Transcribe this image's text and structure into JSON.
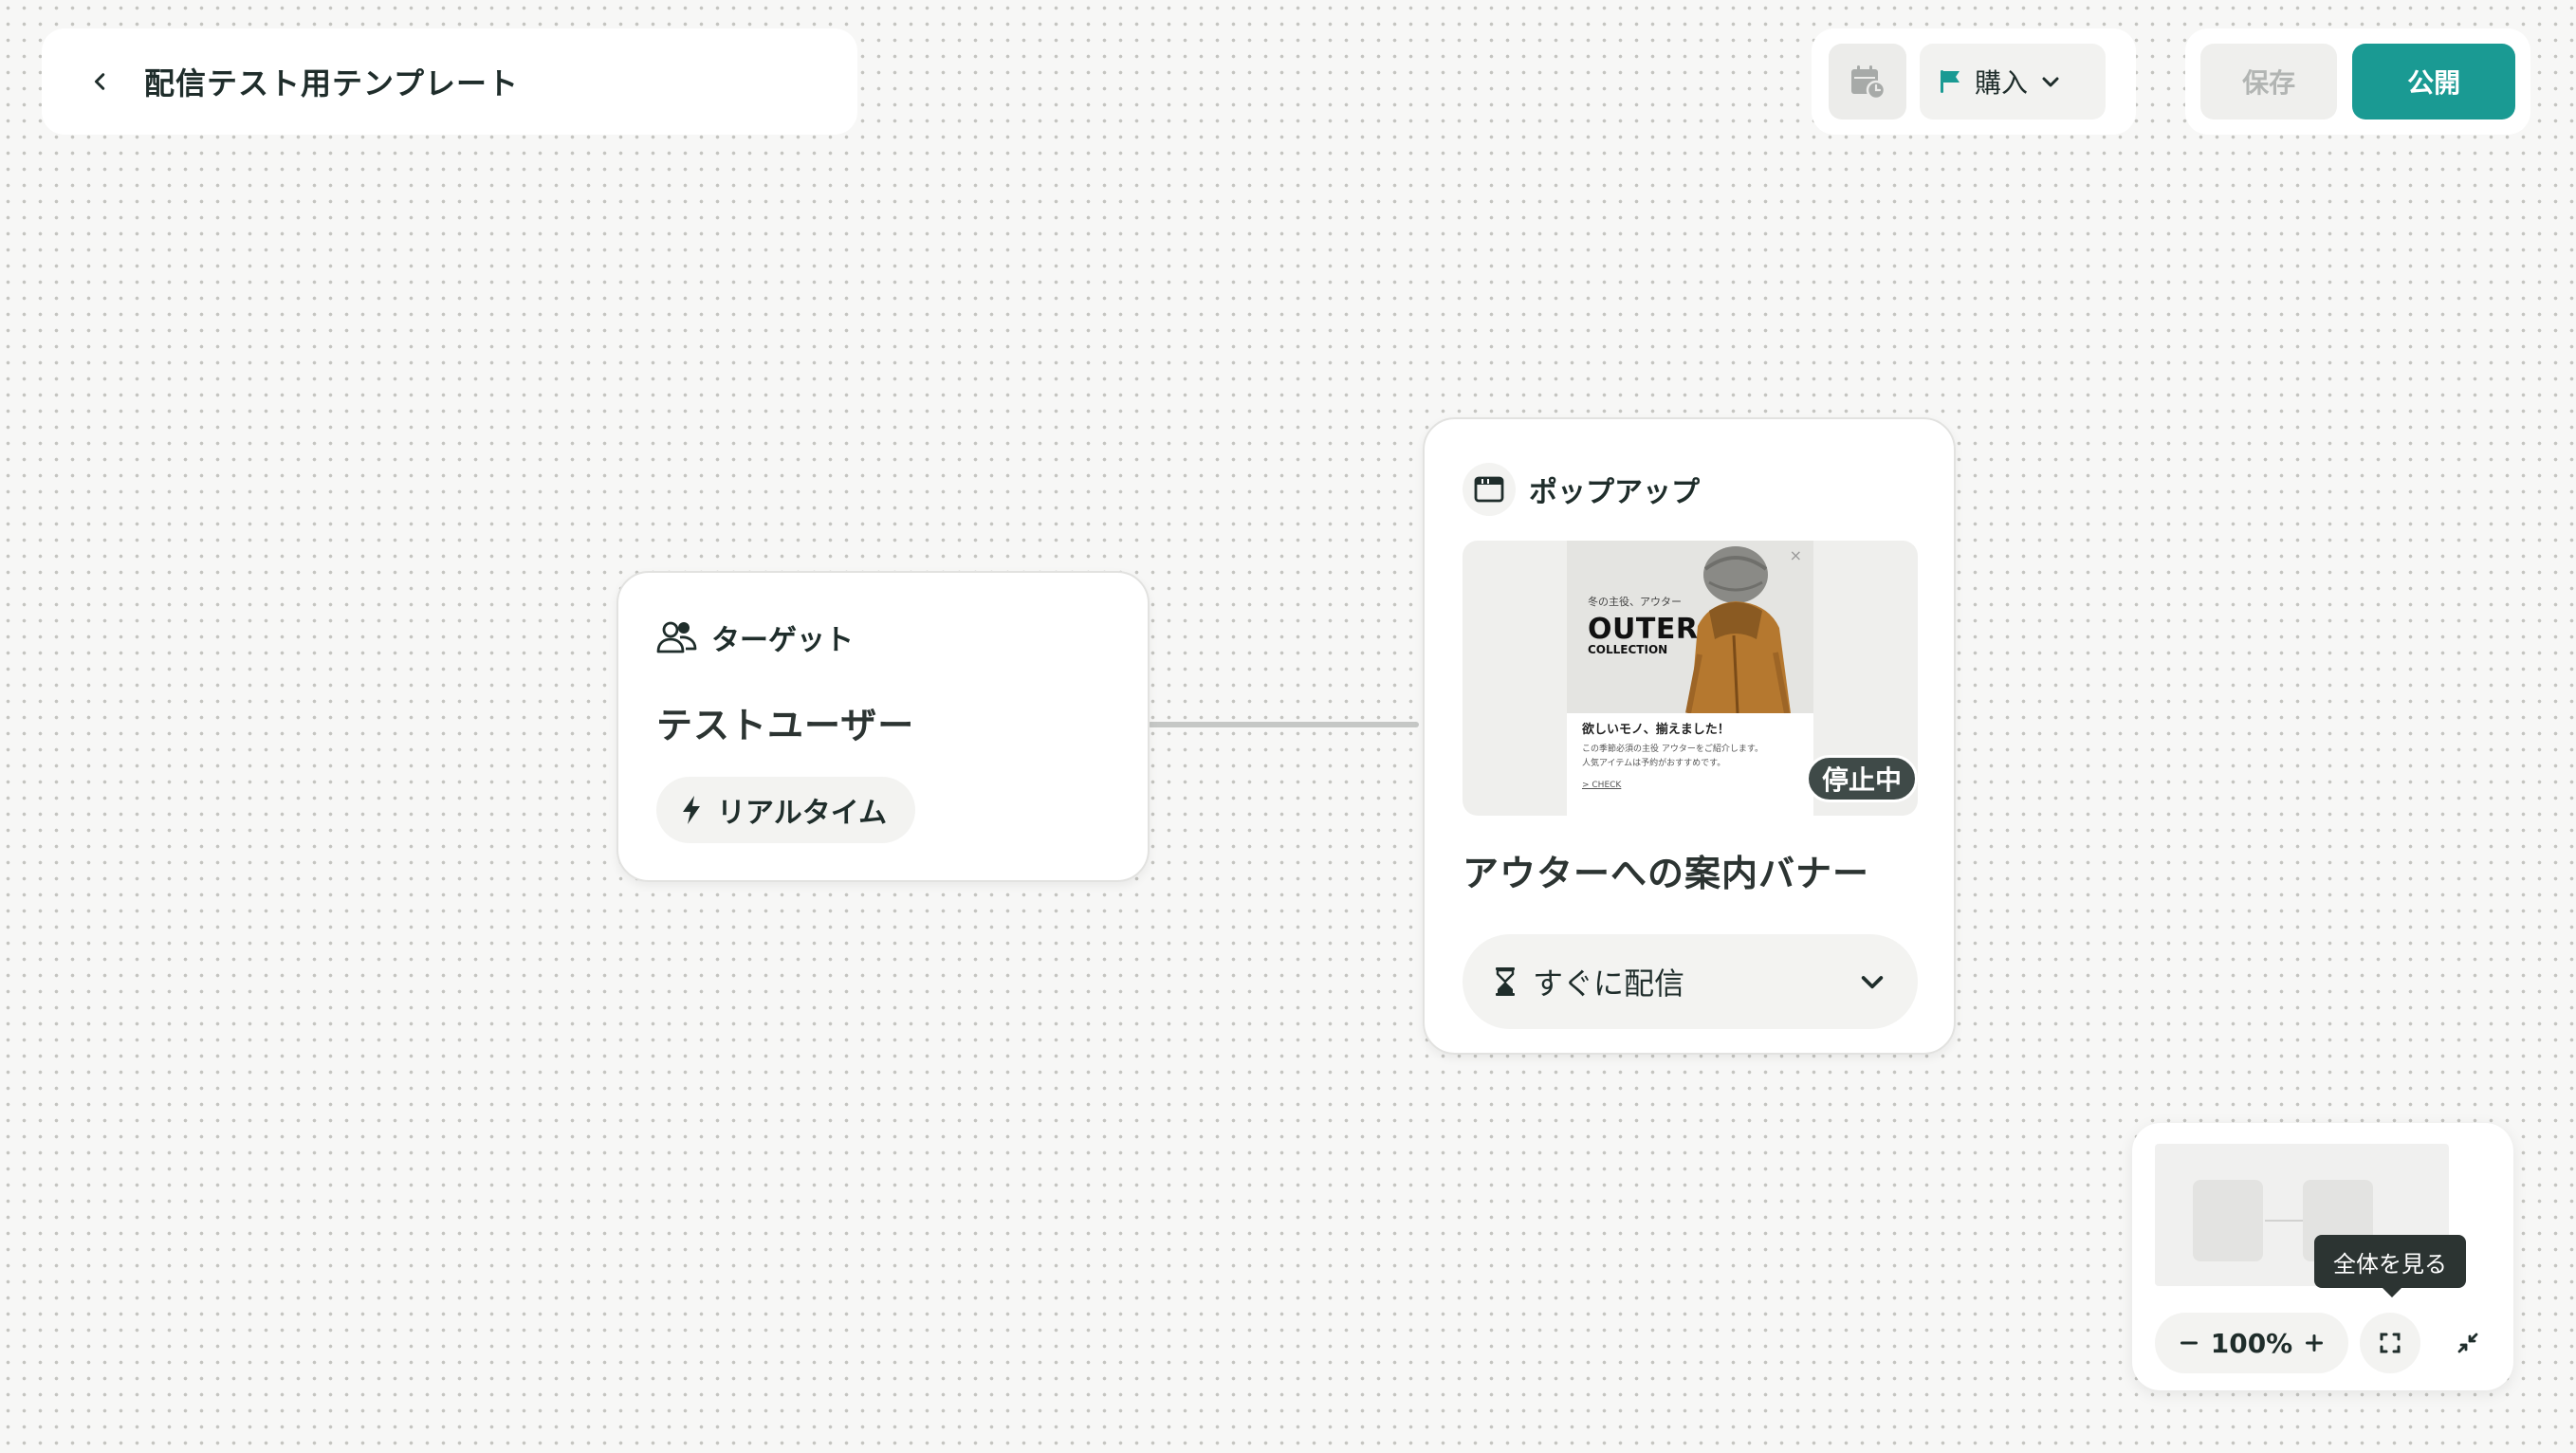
{
  "header": {
    "title": "配信テスト用テンプレート",
    "back_icon": "chevron-left-icon"
  },
  "toolbar": {
    "calendar_icon": "calendar-clock-icon",
    "event_select": {
      "icon": "flag-icon",
      "value": "購入"
    },
    "save_label": "保存",
    "publish_label": "公開",
    "accent_color": "#1a9a93"
  },
  "target_node": {
    "header_label": "ターゲット",
    "header_icon": "users-icon",
    "name": "テストユーザー",
    "timing_chip": {
      "icon": "lightning-icon",
      "label": "リアルタイム"
    }
  },
  "popup_node": {
    "header_label": "ポップアップ",
    "header_icon": "window-icon",
    "preview": {
      "caption": "冬の主役、アウター",
      "headline": "OUTER",
      "subhead": "COLLECTION",
      "body_title": "欲しいモノ、揃えました！",
      "body_line1": "この季節必須の主役 アウターをご紹介します。",
      "body_line2": "人気アイテムは予約がおすすめです。",
      "link": "> CHECK",
      "close": "×"
    },
    "status_badge": "停止中",
    "title": "アウターへの案内バナー",
    "schedule_select": {
      "icon": "hourglass-icon",
      "value": "すぐに配信"
    }
  },
  "minimap": {
    "tooltip": "全体を見る",
    "zoom_level": "100%",
    "zoom_out_icon": "minus-icon",
    "zoom_in_icon": "plus-icon",
    "fit_icon": "fit-screen-icon",
    "collapse_icon": "collapse-icon"
  }
}
